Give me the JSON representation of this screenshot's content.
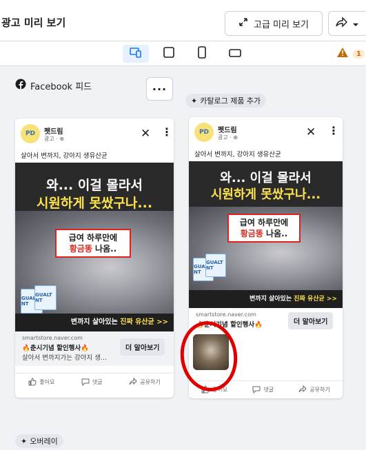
{
  "header": {
    "title": "광고 미리 보기",
    "advanced_preview_label": "고급 미리 보기"
  },
  "device_bar": {
    "warning_count": "1"
  },
  "feed": {
    "label": "Facebook 피드",
    "catalog_chip": "카탈로그 제품 추가",
    "overlay_chip": "오버레이"
  },
  "ad": {
    "page_name_1": "펫드림",
    "page_name_2": "펫드림",
    "sponsored": "광고 · ⊕",
    "primary_text": "살아서 변까지, 강아지 생유산균",
    "headline_line1": "와... 이걸 몰라서",
    "headline_line2": "시원하게 못쌌구나...",
    "box_line1": "급여 하루만에",
    "box_line2_highlight": "황금똥",
    "box_line2_rest": " 나옴..",
    "strip_normal": "변까지 살아있는 ",
    "strip_bold": "진짜 유산균 >>",
    "product_label": "GUALT NT",
    "domain": "smartstore.naver.com",
    "link_headline": "🔥춘시기념 할인행사🔥",
    "link_description": "살아서 변까지가는 강아지 생...",
    "cta_label": "더 알아보기"
  },
  "actions": {
    "like": "좋아요",
    "comment": "댓글",
    "share": "공유하기"
  },
  "colors": {
    "accent": "#1877f2",
    "annotation_red": "#e00000",
    "headline_yellow": "#ffe34d"
  }
}
